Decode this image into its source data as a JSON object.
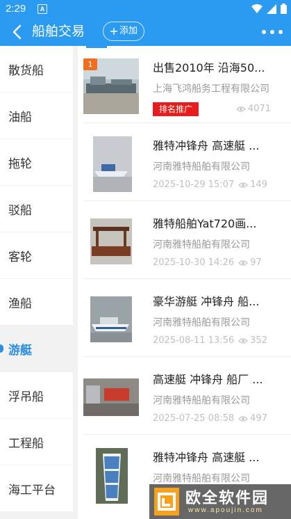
{
  "status_bar": {
    "time": "2:29",
    "app_icon_letter": "A"
  },
  "header": {
    "title": "船舶交易",
    "add_label": "添加"
  },
  "sidebar": {
    "items": [
      {
        "label": "散货船",
        "active": false
      },
      {
        "label": "油船",
        "active": false
      },
      {
        "label": "拖轮",
        "active": false
      },
      {
        "label": "驳船",
        "active": false
      },
      {
        "label": "客轮",
        "active": false
      },
      {
        "label": "渔船",
        "active": false
      },
      {
        "label": "游艇",
        "active": true
      },
      {
        "label": "浮吊船",
        "active": false
      },
      {
        "label": "工程船",
        "active": false
      },
      {
        "label": "海工平台",
        "active": false
      }
    ]
  },
  "listings": [
    {
      "title": "出售2010年 沿海50...",
      "company": "上海飞鸿船务工程有限公司",
      "rank": "1",
      "promo": "排名推广",
      "date": "",
      "views": "4071"
    },
    {
      "title": "雅特冲锋舟 高速艇 ...",
      "company": "河南雅特船舶有限公司",
      "date": "2025-10-29 15:07",
      "views": "149"
    },
    {
      "title": "雅特船舶Yat720画...",
      "company": "河南雅特船舶有限公司",
      "date": "2025-10-30 14:26",
      "views": "97"
    },
    {
      "title": "豪华游艇 冲锋舟 船...",
      "company": "河南雅特船舶有限公司",
      "date": "2025-08-11 13:56",
      "views": "352"
    },
    {
      "title": "高速艇 冲锋舟 船厂 ...",
      "company": "河南雅特船舶有限公司",
      "date": "2025-07-25 08:58",
      "views": "497"
    },
    {
      "title": "雅特冲锋舟 高速艇 ...",
      "company": "河南雅特船舶有限公司",
      "date": "",
      "views": ""
    }
  ],
  "watermark": {
    "name": "欧全软件园",
    "url": "www.apoujin.com"
  },
  "colors": {
    "primary": "#2a9bf0",
    "active": "#2a8fe0",
    "promo": "#e81c1c",
    "badge": "#f07020"
  }
}
